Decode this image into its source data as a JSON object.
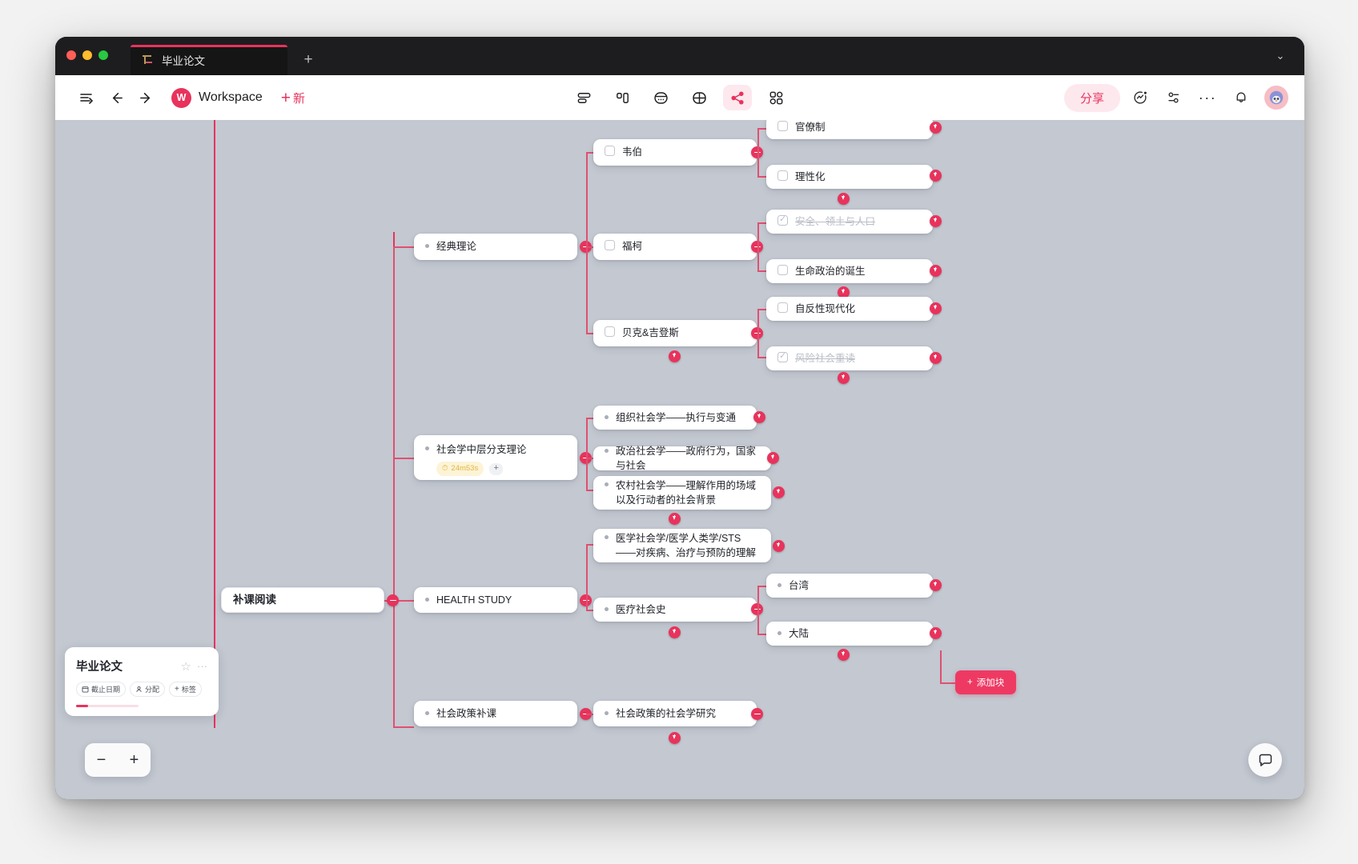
{
  "window": {
    "tab_title": "毕业论文",
    "new_tab_label": "+",
    "chevron": "⌄"
  },
  "toolbar": {
    "workspace_label": "Workspace",
    "new_label": "新",
    "new_plus": "+",
    "share_label": "分享",
    "views": [
      "list-view-icon",
      "board-view-icon",
      "table-view-icon",
      "grid-view-icon",
      "mindmap-view-icon",
      "gallery-view-icon"
    ],
    "active_view": "mindmap-view-icon",
    "right_icons": [
      "activity-icon",
      "filter-icon",
      "more-icon",
      "bell-icon",
      "avatar"
    ]
  },
  "mindmap": {
    "root": {
      "label": "补课阅读"
    },
    "branches": [
      {
        "label": "经典理论",
        "children": [
          {
            "label": "韦伯",
            "type": "checkbox",
            "children": [
              {
                "label": "官僚制",
                "type": "checkbox"
              },
              {
                "label": "理性化",
                "type": "checkbox"
              }
            ]
          },
          {
            "label": "福柯",
            "type": "checkbox",
            "children": [
              {
                "label": "安全、领土与人口",
                "type": "checkbox",
                "done": true
              },
              {
                "label": "生命政治的诞生",
                "type": "checkbox"
              }
            ]
          },
          {
            "label": "贝克&吉登斯",
            "type": "checkbox",
            "children": [
              {
                "label": "自反性现代化",
                "type": "checkbox"
              },
              {
                "label": "风险社会重读",
                "type": "checkbox",
                "done": true
              }
            ]
          }
        ]
      },
      {
        "label": "社会学中层分支理论",
        "tag": {
          "text": "24m53s",
          "icon": "timer-icon"
        },
        "children": [
          {
            "label": "组织社会学——执行与变通"
          },
          {
            "label": "政治社会学——政府行为，国家与社会"
          },
          {
            "label": "农村社会学——理解作用的场域以及行动者的社会背景"
          }
        ]
      },
      {
        "label": "HEALTH STUDY",
        "children": [
          {
            "label": "医学社会学/医学人类学/STS——对疾病、治疗与预防的理解"
          },
          {
            "label": "医疗社会史",
            "children": [
              {
                "label": "台湾"
              },
              {
                "label": "大陆"
              }
            ]
          }
        ]
      },
      {
        "label": "社会政策补课",
        "children": [
          {
            "label": "社会政策的社会学研究"
          }
        ]
      }
    ],
    "add_block_label": "添加块",
    "add_block_plus": "+"
  },
  "minicard": {
    "title": "毕业论文",
    "chips": [
      {
        "label": "截止日期",
        "icon": "calendar-icon"
      },
      {
        "label": "分配",
        "icon": "person-icon"
      },
      {
        "label": "标签",
        "icon": "plus-icon"
      }
    ],
    "star": "☆",
    "more": "···"
  },
  "zoom_control": {
    "minus": "−",
    "plus": "+"
  },
  "colors": {
    "accent": "#e8335c",
    "canvas": "#c3c8d1",
    "connector": "#e05070",
    "tag": "#e0b740"
  }
}
